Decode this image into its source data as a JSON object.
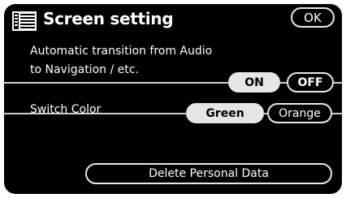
{
  "header": {
    "title": "Screen setting",
    "ok_label": "OK",
    "icon": "screen-setting-icon"
  },
  "settings": [
    {
      "label_lines": [
        "Automatic transition from Audio",
        "to Navigation / etc."
      ],
      "options": [
        "ON",
        "OFF"
      ],
      "selected": "ON"
    },
    {
      "label_lines": [
        "Switch Color"
      ],
      "options": [
        "Green",
        "Orange"
      ],
      "selected": "Green"
    }
  ],
  "footer": {
    "delete_label": "Delete Personal Data"
  },
  "colors": {
    "background": "#000000",
    "selected_fill": "#e6e6e6",
    "border": "#e8e8e8",
    "text": "#ffffff"
  }
}
